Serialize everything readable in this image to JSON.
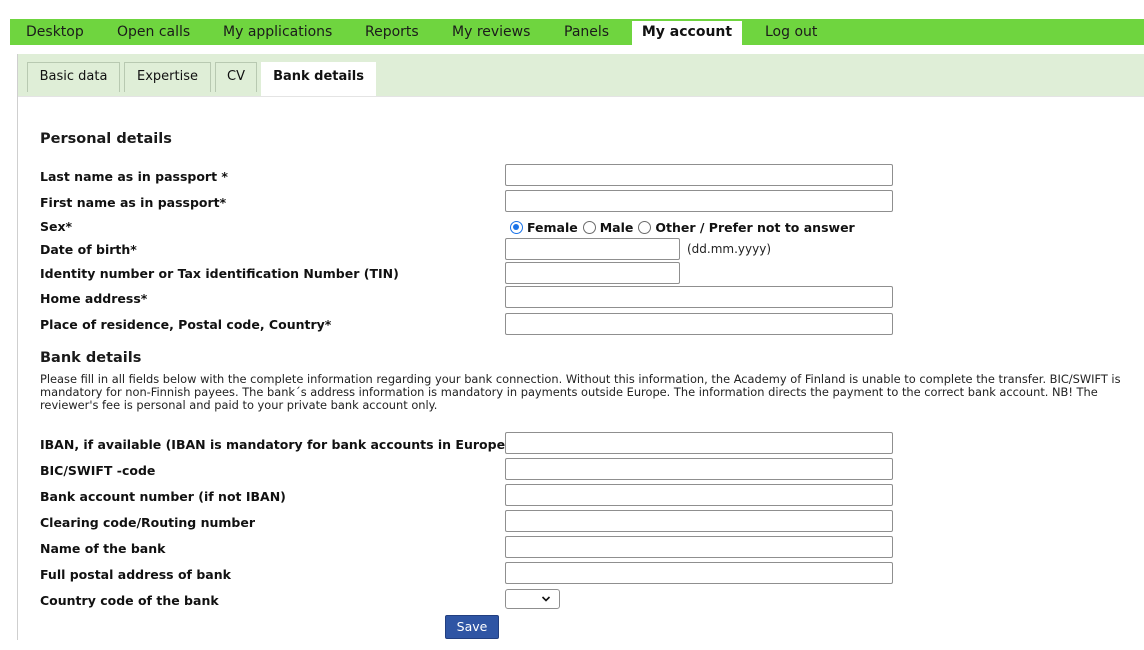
{
  "nav": {
    "items": [
      "Desktop",
      "Open calls",
      "My applications",
      "Reports",
      "My reviews",
      "Panels",
      "My account",
      "Log out"
    ],
    "active": "My account"
  },
  "subtabs": {
    "items": [
      "Basic data",
      "Expertise",
      "CV",
      "Bank details"
    ],
    "active": "Bank details"
  },
  "personal": {
    "heading": "Personal details",
    "last_name_label": "Last name as in passport *",
    "first_name_label": "First name as in passport*",
    "sex_label": "Sex*",
    "sex_options": [
      "Female",
      "Male",
      "Other / Prefer not to answer"
    ],
    "sex_selected": "Female",
    "dob_label": "Date of birth*",
    "dob_hint": "(dd.mm.yyyy)",
    "tin_label": "Identity number or Tax identification Number (TIN)",
    "address_label": "Home address*",
    "residence_label": "Place of residence, Postal code, Country*"
  },
  "bank": {
    "heading": "Bank details",
    "info": "Please fill in all fields below with the complete information regarding your bank connection. Without this information, the Academy of Finland is unable to complete the transfer. BIC/SWIFT is mandatory for non-Finnish payees. The bank´s address information is mandatory in payments outside Europe. The information directs the payment to the correct bank account. NB! The reviewer's fee is personal and paid to your private bank account only.",
    "iban_label": "IBAN, if available (IBAN is mandatory for bank accounts in Europe)",
    "bic_label": "BIC/SWIFT -code",
    "account_label": "Bank account number (if not IBAN)",
    "clearing_label": "Clearing code/Routing number",
    "bank_name_label": "Name of the bank",
    "bank_address_label": "Full postal address of bank",
    "country_label": "Country code of the bank",
    "country_selected": ""
  },
  "save_label": "Save",
  "colors": {
    "nav_bg": "#6fd53f",
    "subtab_bg": "#dfeed7",
    "save_bg": "#2f55a4",
    "radio_accent": "#1a73e8"
  }
}
